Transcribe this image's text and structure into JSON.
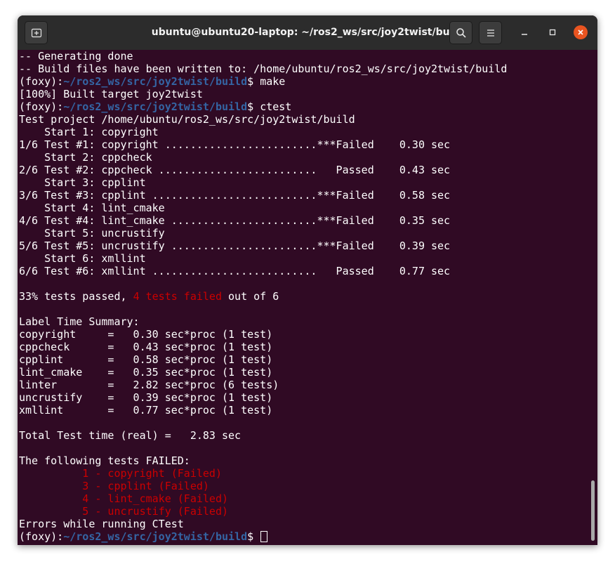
{
  "window": {
    "title": "ubuntu@ubuntu20-laptop: ~/ros2_ws/src/joy2twist/build",
    "icons": {
      "new_tab": "new-tab-icon",
      "search": "search-icon",
      "menu": "hamburger-menu-icon",
      "minimize": "minimize-icon",
      "maximize": "maximize-icon",
      "close": "close-icon"
    },
    "colors": {
      "terminal_bg": "#300a24",
      "titlebar_bg": "#2c2c2c",
      "prompt_path": "#3465a4",
      "error_red": "#cc0000",
      "close_button": "#e95420"
    }
  },
  "terminal": {
    "lines": [
      "-- Generating done",
      "-- Build files have been written to: /home/ubuntu/ros2_ws/src/joy2twist/build",
      "[100%] Built target joy2twist",
      "Test project /home/ubuntu/ros2_ws/src/joy2twist/build",
      "    Start 1: copyright",
      "1/6 Test #1: copyright ........................***Failed    0.30 sec",
      "    Start 2: cppcheck",
      "2/6 Test #2: cppcheck .........................   Passed    0.43 sec",
      "    Start 3: cpplint",
      "3/6 Test #3: cpplint ..........................***Failed    0.58 sec",
      "    Start 4: lint_cmake",
      "4/6 Test #4: lint_cmake .......................***Failed    0.35 sec",
      "    Start 5: uncrustify",
      "5/6 Test #5: uncrustify .......................***Failed    0.39 sec",
      "    Start 6: xmllint",
      "6/6 Test #6: xmllint ..........................   Passed    0.77 sec",
      "33% tests passed, ",
      "4 tests failed",
      " out of 6",
      "Label Time Summary:",
      "copyright     =   0.30 sec*proc (1 test)",
      "cppcheck      =   0.43 sec*proc (1 test)",
      "cpplint       =   0.58 sec*proc (1 test)",
      "lint_cmake    =   0.35 sec*proc (1 test)",
      "linter        =   2.82 sec*proc (6 tests)",
      "uncrustify    =   0.39 sec*proc (1 test)",
      "xmllint       =   0.77 sec*proc (1 test)",
      "Total Test time (real) =   2.83 sec",
      "The following tests FAILED:",
      "\t  1 - copyright (Failed)",
      "\t  3 - cpplint (Failed)",
      "\t  4 - lint_cmake (Failed)",
      "\t  5 - uncrustify (Failed)",
      "Errors while running CTest"
    ],
    "prompt": {
      "env": "(foxy):",
      "path": "~/ros2_ws/src/joy2twist/build",
      "symbol": "$ "
    },
    "commands": {
      "make": "make",
      "ctest": "ctest"
    }
  }
}
